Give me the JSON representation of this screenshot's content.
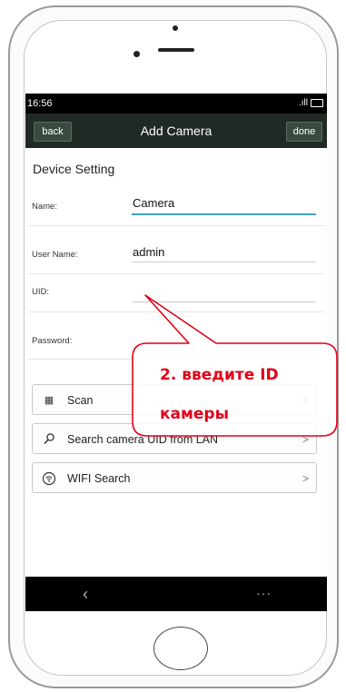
{
  "status_bar": {
    "time": "16:56",
    "signal": ".ıll"
  },
  "header": {
    "title": "Add Camera",
    "back_label": "back",
    "done_label": "done"
  },
  "section": {
    "title": "Device Setting"
  },
  "fields": {
    "name": {
      "label": "Name:",
      "value": "Camera"
    },
    "user_name": {
      "label": "User Name:",
      "value": "admin"
    },
    "uid": {
      "label": "UID:",
      "value": ""
    },
    "password": {
      "label": "Password:",
      "value": ""
    }
  },
  "actions": {
    "scan": {
      "label": "Scan",
      "icon": "qr-scan-icon"
    },
    "lan_search": {
      "label": "Search camera UID from LAN",
      "icon": "search-icon"
    },
    "wifi_search": {
      "label": "WIFI Search",
      "icon": "wifi-icon"
    }
  },
  "nav": {
    "back_glyph": "‹",
    "menu_glyph": "···"
  },
  "callout": {
    "line1": "2. введите ID",
    "line2": "камеры",
    "color": "#e0001a"
  }
}
